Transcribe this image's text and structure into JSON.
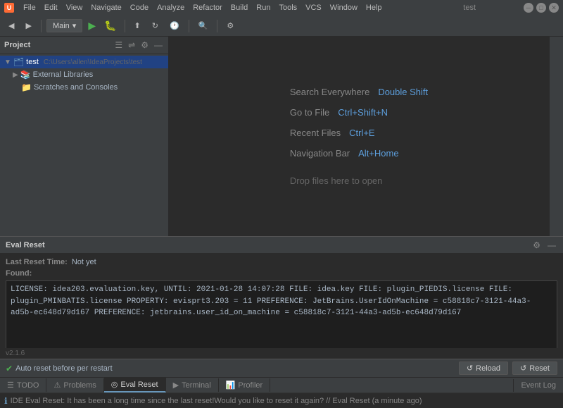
{
  "titleBar": {
    "title": "test",
    "menuItems": [
      "File",
      "Edit",
      "View",
      "Navigate",
      "Code",
      "Analyze",
      "Refactor",
      "Build",
      "Run",
      "Tools",
      "VCS",
      "Window",
      "Help"
    ]
  },
  "toolbar": {
    "mainDropdown": "Main",
    "runBtn": "▶",
    "debugBtn": "🐛"
  },
  "sidebar": {
    "title": "Project",
    "projectItems": [
      {
        "label": "test",
        "path": "C:\\Users\\allen\\IdeaProjects\\test",
        "indent": 0,
        "selected": true
      },
      {
        "label": "External Libraries",
        "indent": 1
      },
      {
        "label": "Scratches and Consoles",
        "indent": 2
      }
    ]
  },
  "editor": {
    "hints": [
      {
        "label": "Search Everywhere",
        "shortcut": "Double Shift"
      },
      {
        "label": "Go to File",
        "shortcut": "Ctrl+Shift+N"
      },
      {
        "label": "Recent Files",
        "shortcut": "Ctrl+E"
      },
      {
        "label": "Navigation Bar",
        "shortcut": "Alt+Home"
      }
    ],
    "dropHint": "Drop files here to open"
  },
  "bottomPanel": {
    "title": "Eval Reset",
    "lastResetLabel": "Last Reset Time:",
    "lastResetValue": "Not yet",
    "foundLabel": "Found:",
    "contentLines": [
      "LICENSE: idea203.evaluation.key, UNTIL: 2021-01-28 14:07:28",
      "FILE: idea.key",
      "FILE: plugin_PIEDIS.license",
      "FILE: plugin_PMINBATIS.license",
      "PROPERTY: evisprt3.203 = 11",
      "PREFERENCE: JetBrains.UserIdOnMachine = c58818c7-3121-44a3-ad5b-ec648d79d167",
      "PREFERENCE: jetbrains.user_id_on_machine = c58818c7-3121-44a3-ad5b-ec648d79d167"
    ],
    "version": "v2.1.6",
    "autoResetLabel": "Auto reset before per restart",
    "reloadBtn": "↺  Reload",
    "resetBtn": "↺  Reset"
  },
  "bottomTabs": [
    {
      "id": "todo",
      "label": "TODO",
      "icon": "☰",
      "active": false
    },
    {
      "id": "problems",
      "label": "Problems",
      "icon": "⚠",
      "active": false
    },
    {
      "id": "evalreset",
      "label": "Eval Reset",
      "icon": "◎",
      "active": true
    },
    {
      "id": "terminal",
      "label": "Terminal",
      "icon": "▶",
      "active": false
    },
    {
      "id": "profiler",
      "label": "Profiler",
      "icon": "📊",
      "active": false
    }
  ],
  "eventLog": {
    "label": "Event Log"
  },
  "statusMsg": "IDE Eval Reset: It has been a long time since the last reset!Would you like to reset it again? // Eval Reset (a minute ago)"
}
